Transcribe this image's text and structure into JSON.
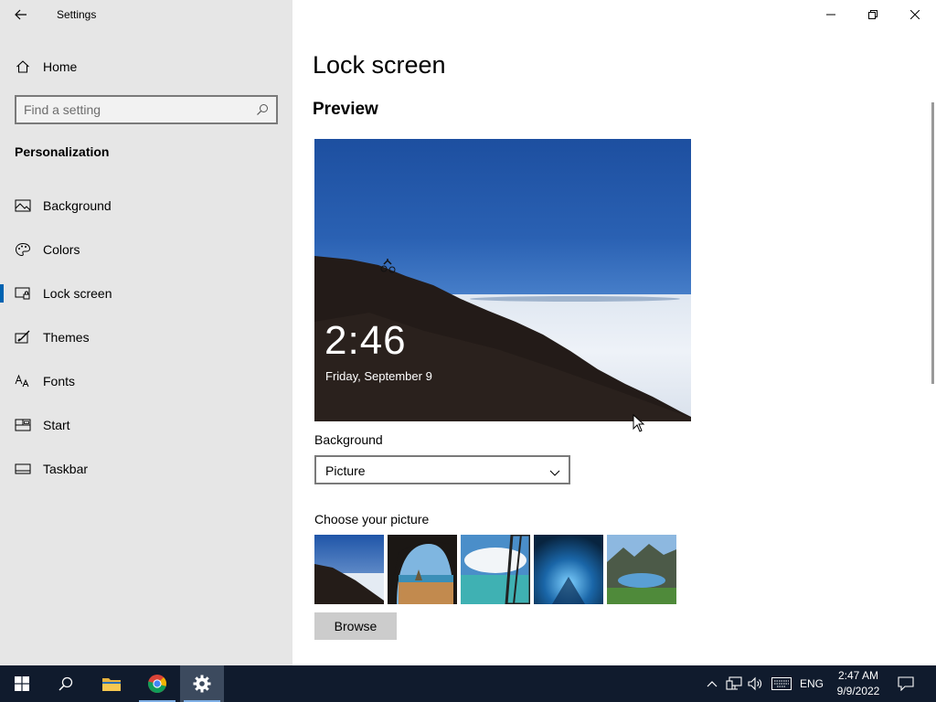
{
  "window": {
    "app_title": "Settings"
  },
  "sidebar": {
    "home_label": "Home",
    "search_placeholder": "Find a setting",
    "section_title": "Personalization",
    "items": [
      {
        "label": "Background",
        "icon": "picture-icon"
      },
      {
        "label": "Colors",
        "icon": "palette-icon"
      },
      {
        "label": "Lock screen",
        "icon": "lock-screen-icon",
        "selected": true
      },
      {
        "label": "Themes",
        "icon": "themes-icon"
      },
      {
        "label": "Fonts",
        "icon": "fonts-icon"
      },
      {
        "label": "Start",
        "icon": "start-icon"
      },
      {
        "label": "Taskbar",
        "icon": "taskbar-icon"
      }
    ]
  },
  "main": {
    "title": "Lock screen",
    "preview_heading": "Preview",
    "preview_time": "2:46",
    "preview_date": "Friday, September 9",
    "background_label": "Background",
    "background_value": "Picture",
    "choose_label": "Choose your picture",
    "browse_label": "Browse"
  },
  "taskbar": {
    "language": "ENG",
    "time": "2:47 AM",
    "date": "9/9/2022"
  },
  "colors": {
    "accent": "#0063b1",
    "sidebar_bg": "#e6e6e6",
    "taskbar_bg": "#101b2d"
  }
}
